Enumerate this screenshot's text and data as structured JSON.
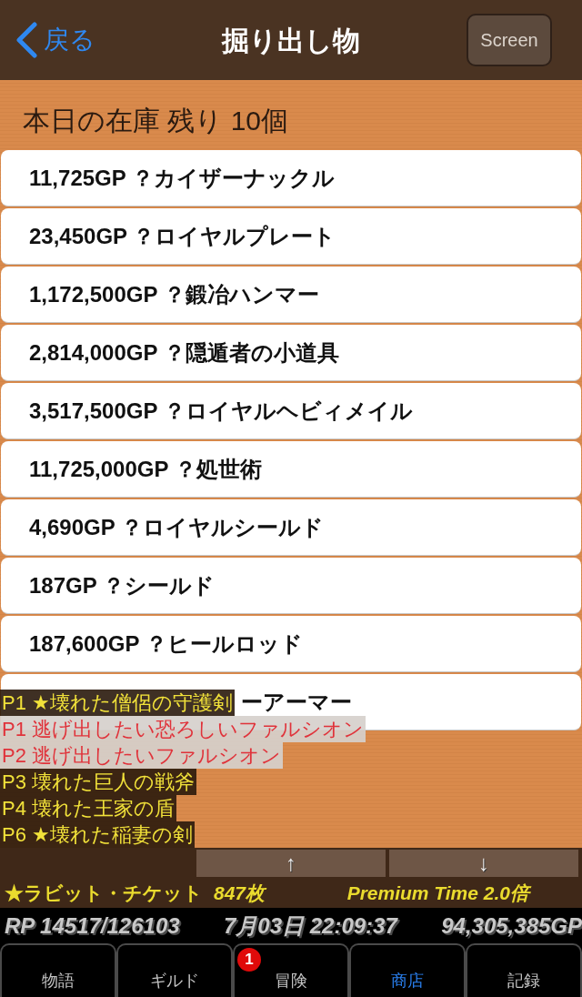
{
  "nav": {
    "back": "戻る",
    "title": "掘り出し物",
    "screen_button": "Screen"
  },
  "stock_header": "本日の在庫 残り 10個",
  "items": [
    {
      "text": "11,725GP ？カイザーナックル",
      "kind": "full"
    },
    {
      "text": "23,450GP ？ロイヤルプレート",
      "kind": "full"
    },
    {
      "text": "1,172,500GP ？鍛冶ハンマー",
      "kind": "full"
    },
    {
      "text": "2,814,000GP ？隠遁者の小道具",
      "kind": "full"
    },
    {
      "text": "3,517,500GP ？ロイヤルヘビィメイル",
      "kind": "full"
    },
    {
      "text": "11,725,000GP ？処世術",
      "kind": "full"
    },
    {
      "text": "4,690GP ？ロイヤルシールド",
      "kind": "full"
    },
    {
      "text": "187GP ？シールド",
      "kind": "full"
    },
    {
      "text": "187,600GP ？ヒールロッド",
      "kind": "full"
    },
    {
      "text": "ーアーマー",
      "kind": "covered"
    }
  ],
  "log": [
    {
      "text": "P1 ★壊れた僧侶の守護剣",
      "kind": "normal"
    },
    {
      "text": "P1 逃げ出したい恐ろしいファルシオン",
      "kind": "alert"
    },
    {
      "text": "P2 逃げ出したいファルシオン",
      "kind": "alert"
    },
    {
      "text": "P3 壊れた巨人の戦斧",
      "kind": "normal"
    },
    {
      "text": "P4 壊れた王家の盾",
      "kind": "normal"
    },
    {
      "text": "P6 ★壊れた稲妻の剣",
      "kind": "normal"
    }
  ],
  "scroll_buttons": [
    "↑",
    "↓"
  ],
  "ticket": {
    "label": "★ラビット・チケット",
    "count": "847枚"
  },
  "premium": "Premium Time 2.0倍",
  "status": {
    "rp": "RP 14517/126103",
    "datetime": "7月03日 22:09:37",
    "money": "94,305,385GP"
  },
  "tabs": [
    {
      "label": "物語",
      "selected": false
    },
    {
      "label": "ギルド",
      "selected": false
    },
    {
      "label": "冒険",
      "selected": false,
      "badge": "1"
    },
    {
      "label": "商店",
      "selected": true
    },
    {
      "label": "記録",
      "selected": false
    }
  ]
}
